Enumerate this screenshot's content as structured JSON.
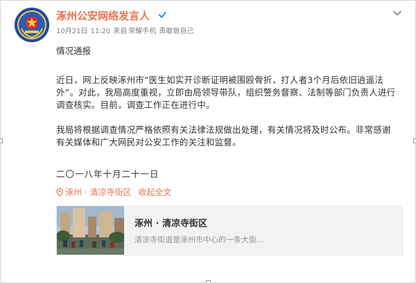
{
  "author": {
    "name": "涿州公安网络发言人",
    "verified_icon": "verified-badge-icon",
    "verified_color": "#1f9bf0",
    "name_color": "#eb7350"
  },
  "meta": {
    "date": "10月21日",
    "time": "11:20",
    "source_prefix": "来自",
    "device": "荣耀手机",
    "device_suffix": "勇敢做自己"
  },
  "post": {
    "headline": "情况通报",
    "paragraph1": "近日，网上反映涿州市“医生如实开诊断证明被围殴骨折，打人者3个月后依旧逍遥法外”。对此，我局高度重视，立即由局领导带队，组织警务督察、法制等部门负责人进行调查核实。目前，调查工作正在进行中。",
    "paragraph2": "我局将根据调查情况严格依照有关法律法规做出处理，有关情况将及时公布。非常感谢有关媒体和广大网民对公安工作的关注和监督。",
    "date_line": "二〇一八年十月二十一日"
  },
  "location": {
    "icon": "map-pin-icon",
    "text": "涿州 · 清凉寺街区",
    "collapse_label": "收起全文"
  },
  "card": {
    "title": "涿州 · 清凉寺街区",
    "description": "清凉寺街道是涿州市中心的一条大街..."
  },
  "colors": {
    "accent": "#eb7350",
    "text": "#333333",
    "meta": "#808080",
    "card_bg": "#f2f2f5"
  }
}
